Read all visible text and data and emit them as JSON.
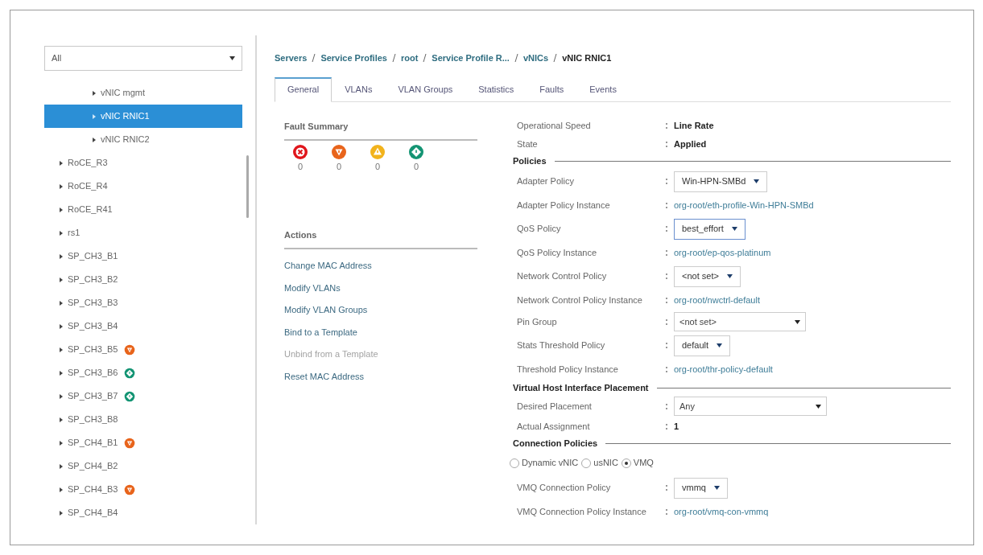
{
  "filter": {
    "value": "All"
  },
  "tree": {
    "subitems": [
      {
        "label": "vNIC mgmt",
        "selected": false
      },
      {
        "label": "vNIC RNIC1",
        "selected": true
      },
      {
        "label": "vNIC RNIC2",
        "selected": false
      }
    ],
    "items": [
      {
        "kind": "plain",
        "label": "RoCE_R3",
        "selected": false
      },
      {
        "kind": "plain",
        "label": "RoCE_R4",
        "selected": false
      },
      {
        "kind": "plain",
        "label": "RoCE_R41",
        "selected": false
      },
      {
        "kind": "plain",
        "label": "rs1",
        "selected": false
      },
      {
        "kind": "plain",
        "label": "SP_CH3_B1",
        "selected": false
      },
      {
        "kind": "plain",
        "label": "SP_CH3_B2",
        "selected": false
      },
      {
        "kind": "plain",
        "label": "SP_CH3_B3",
        "selected": false
      },
      {
        "kind": "plain",
        "label": "SP_CH3_B4",
        "selected": false
      },
      {
        "kind": "major",
        "label": "SP_CH3_B5",
        "selected": false
      },
      {
        "kind": "warning",
        "label": "SP_CH3_B6",
        "selected": false
      },
      {
        "kind": "warning",
        "label": "SP_CH3_B7",
        "selected": false
      },
      {
        "kind": "plain",
        "label": "SP_CH3_B8",
        "selected": false
      },
      {
        "kind": "major",
        "label": "SP_CH4_B1",
        "selected": false
      },
      {
        "kind": "plain",
        "label": "SP_CH4_B2",
        "selected": false
      },
      {
        "kind": "major",
        "label": "SP_CH4_B3",
        "selected": false
      },
      {
        "kind": "plain",
        "label": "SP_CH4_B4",
        "selected": false
      }
    ]
  },
  "breadcrumb": [
    "Servers",
    "Service Profiles",
    "root",
    "Service Profile R...",
    "vNICs",
    "vNIC RNIC1"
  ],
  "tabs": [
    {
      "label": "General",
      "selected": true
    },
    {
      "label": "VLANs",
      "selected": false
    },
    {
      "label": "VLAN Groups",
      "selected": false
    },
    {
      "label": "Statistics",
      "selected": false
    },
    {
      "label": "Faults",
      "selected": false
    },
    {
      "label": "Events",
      "selected": false
    }
  ],
  "fault_summary": {
    "title": "Fault Summary",
    "faults": [
      {
        "kind": "critical",
        "count": "0"
      },
      {
        "kind": "major",
        "count": "0"
      },
      {
        "kind": "minor",
        "count": "0"
      },
      {
        "kind": "warning",
        "count": "0"
      }
    ]
  },
  "actions": {
    "title": "Actions",
    "items": [
      {
        "label": "Change MAC Address",
        "disabled": false
      },
      {
        "label": "Modify VLANs",
        "disabled": false
      },
      {
        "label": "Modify VLAN Groups",
        "disabled": false
      },
      {
        "label": "Bind to a Template",
        "disabled": false
      },
      {
        "label": "Unbind from a Template",
        "disabled": true
      },
      {
        "label": "Reset MAC Address",
        "disabled": false
      }
    ]
  },
  "properties": [
    {
      "kind": "text",
      "label": "Operational Speed",
      "value": "Line Rate"
    },
    {
      "kind": "text",
      "label": "State",
      "value": "Applied"
    },
    {
      "kind": "heading",
      "label": "Policies"
    },
    {
      "kind": "select",
      "label": "Adapter Policy",
      "value": "Win-HPN-SMBd",
      "focused": false
    },
    {
      "kind": "link",
      "label": "Adapter Policy Instance",
      "value": "org-root/eth-profile-Win-HPN-SMBd"
    },
    {
      "kind": "select",
      "label": "QoS Policy",
      "value": "best_effort",
      "focused": true
    },
    {
      "kind": "link",
      "label": "QoS Policy Instance",
      "value": "org-root/ep-qos-platinum"
    },
    {
      "kind": "select",
      "label": "Network Control Policy",
      "value": "<not set>",
      "focused": false
    },
    {
      "kind": "link",
      "label": "Network Control Policy Instance",
      "value": "org-root/nwctrl-default"
    },
    {
      "kind": "wide-select",
      "label": "Pin Group",
      "value": "<not set>"
    },
    {
      "kind": "select",
      "label": "Stats Threshold Policy",
      "value": "default",
      "focused": false
    },
    {
      "kind": "link",
      "label": "Threshold Policy Instance",
      "value": "org-root/thr-policy-default"
    },
    {
      "kind": "heading",
      "label": "Virtual Host Interface Placement"
    },
    {
      "kind": "wide-select",
      "label": "Desired Placement",
      "value": "Any"
    },
    {
      "kind": "text",
      "label": "Actual Assignment",
      "value": "1"
    },
    {
      "kind": "heading",
      "label": "Connection Policies"
    },
    {
      "kind": "radios",
      "options": [
        {
          "label": "Dynamic vNIC",
          "selected": false
        },
        {
          "label": "usNIC",
          "selected": false
        },
        {
          "label": "VMQ",
          "selected": true
        }
      ]
    },
    {
      "kind": "select",
      "label": "VMQ Connection Policy",
      "value": "vmmq",
      "focused": false
    },
    {
      "kind": "link",
      "label": "VMQ Connection Policy Instance",
      "value": "org-root/vmq-con-vmmq"
    }
  ]
}
